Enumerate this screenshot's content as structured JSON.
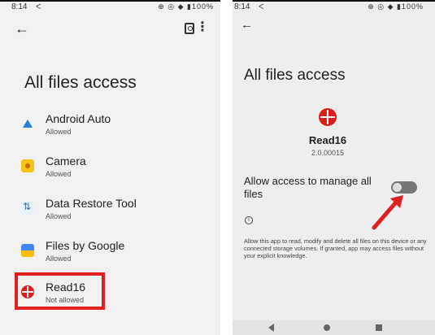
{
  "left": {
    "status": {
      "time": "8:14",
      "notif": "ᐸ",
      "sys": "⊕ ◎ ◆ ▮100%"
    },
    "title": "All files access",
    "apps": [
      {
        "name": "Android Auto",
        "status": "Allowed",
        "icon": "android-auto-icon"
      },
      {
        "name": "Camera",
        "status": "Allowed",
        "icon": "camera-icon"
      },
      {
        "name": "Data Restore Tool",
        "status": "Allowed",
        "icon": "data-restore-icon"
      },
      {
        "name": "Files by Google",
        "status": "Allowed",
        "icon": "files-by-google-icon"
      },
      {
        "name": "Read16",
        "status": "Not allowed",
        "icon": "read16-icon"
      }
    ]
  },
  "right": {
    "status": {
      "time": "8:14",
      "notif": "ᐸ",
      "sys": "⊕ ◎ ◆ ▮100%"
    },
    "title": "All files access",
    "app_name": "Read16",
    "app_version": "2.0.00015",
    "toggle_label": "Allow access to manage all files",
    "toggle_on": false,
    "info_text": "Allow this app to read, modify and delete all files on this device or any connected storage volumes. If granted, app may access files without your explicit knowledge."
  },
  "colors": {
    "accent_red": "#e02020",
    "toggle_off": "#777777"
  }
}
